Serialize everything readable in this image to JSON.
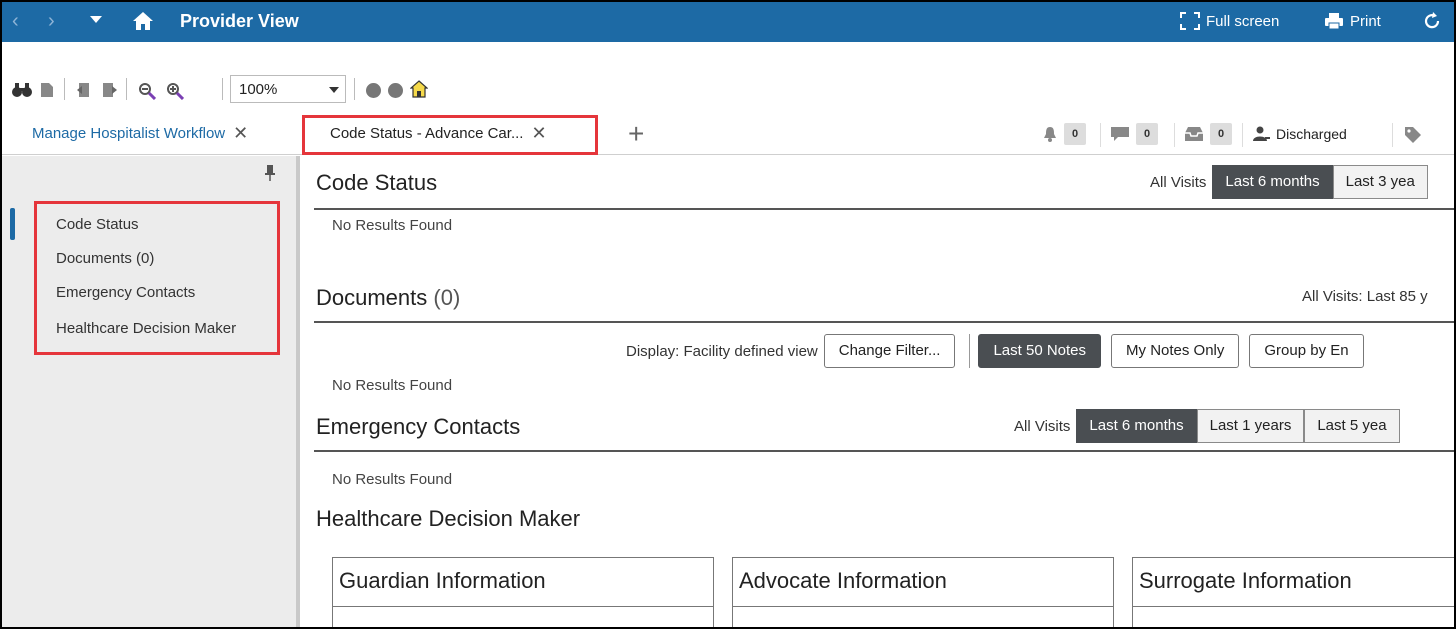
{
  "titlebar": {
    "title": "Provider View",
    "full_screen": "Full screen",
    "print": "Print"
  },
  "toolbar": {
    "zoom": "100%"
  },
  "tabs": {
    "tab1": "Manage Hospitalist Workflow",
    "tab2": "Code Status - Advance Car...",
    "indicators": [
      {
        "icon": "bell-icon",
        "count": "0"
      },
      {
        "icon": "chat-icon",
        "count": "0"
      },
      {
        "icon": "inbox-icon",
        "count": "0"
      }
    ],
    "status": "Discharged"
  },
  "sidebar": {
    "items": [
      "Code Status",
      "Documents (0)",
      "Emergency Contacts",
      "Healthcare Decision Maker"
    ]
  },
  "main": {
    "code_status": {
      "title": "Code Status",
      "all_visits": "All Visits",
      "ranges": [
        "Last 6 months",
        "Last 3 yea"
      ],
      "no_results": "No Results Found"
    },
    "documents": {
      "title": "Documents",
      "count": "(0)",
      "all_visits": "All Visits: Last 85 y",
      "display_label": "Display: Facility defined view",
      "change_filter": "Change Filter...",
      "buttons": [
        "Last 50 Notes",
        "My Notes Only",
        "Group by En"
      ],
      "no_results": "No Results Found"
    },
    "emergency": {
      "title": "Emergency Contacts",
      "all_visits": "All Visits",
      "ranges": [
        "Last 6 months",
        "Last 1 years",
        "Last 5 yea"
      ],
      "no_results": "No Results Found"
    },
    "hdm": {
      "title": "Healthcare Decision Maker",
      "cards": [
        "Guardian Information",
        "Advocate Information",
        "Surrogate Information"
      ]
    }
  },
  "colors": {
    "header_blue": "#1d6aa5",
    "highlight_red": "#e5353b",
    "active_dark": "#4a4e52"
  }
}
